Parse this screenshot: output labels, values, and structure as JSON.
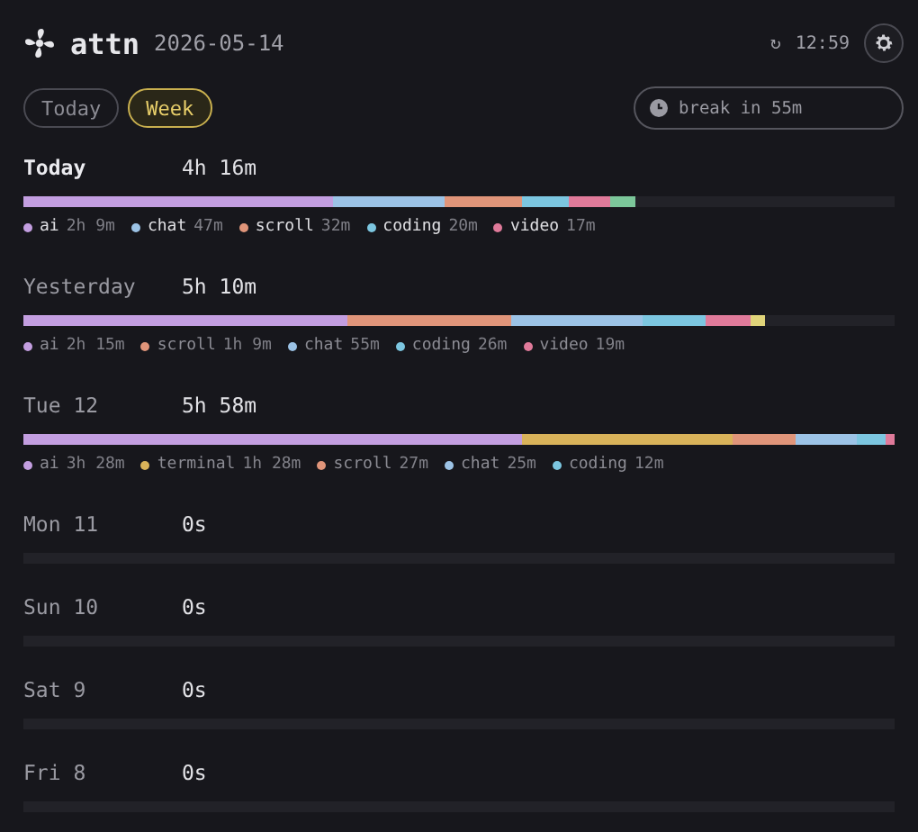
{
  "header": {
    "app_name": "attn",
    "date": "2026-05-14",
    "sync_icon": "↻",
    "time": "12:59"
  },
  "tabs": [
    {
      "label": "Today",
      "selected": false
    },
    {
      "label": "Week",
      "selected": true
    }
  ],
  "break_field": {
    "value": "break in 55m"
  },
  "days": [
    {
      "label": "Today",
      "total": "4h 16m",
      "selected": true,
      "segments": [
        {
          "color": "#c39ee0"
        },
        {
          "color": "#9cc3e6"
        },
        {
          "color": "#e0957a"
        },
        {
          "color": "#7cc6e0"
        },
        {
          "color": "#e07a9a"
        },
        {
          "color": "#7cc79a"
        }
      ],
      "legend": [
        {
          "name": "ai",
          "value": "2h 9m",
          "color": "#c39ee0"
        },
        {
          "name": "chat",
          "value": "47m",
          "color": "#9cc3e6"
        },
        {
          "name": "scroll",
          "value": "32m",
          "color": "#e0957a"
        },
        {
          "name": "coding",
          "value": "20m",
          "color": "#7cc6e0"
        },
        {
          "name": "video",
          "value": "17m",
          "color": "#e07a9a"
        }
      ]
    },
    {
      "label": "Yesterday",
      "total": "5h 10m",
      "selected": false,
      "segments": [
        {
          "color": "#c39ee0"
        },
        {
          "color": "#e0957a"
        },
        {
          "color": "#9cc3e6"
        },
        {
          "color": "#7cc6e0"
        },
        {
          "color": "#e07a9a"
        },
        {
          "color": "#e0d47a"
        }
      ],
      "legend": [
        {
          "name": "ai",
          "value": "2h 15m",
          "color": "#c39ee0"
        },
        {
          "name": "scroll",
          "value": "1h 9m",
          "color": "#e0957a"
        },
        {
          "name": "chat",
          "value": "55m",
          "color": "#9cc3e6"
        },
        {
          "name": "coding",
          "value": "26m",
          "color": "#7cc6e0"
        },
        {
          "name": "video",
          "value": "19m",
          "color": "#e07a9a"
        }
      ]
    },
    {
      "label": "Tue 12",
      "total": "5h 58m",
      "selected": false,
      "segments": [
        {
          "color": "#c39ee0"
        },
        {
          "color": "#d9b35a"
        },
        {
          "color": "#e0957a"
        },
        {
          "color": "#9cc3e6"
        },
        {
          "color": "#7cc6e0"
        },
        {
          "color": "#e07a9a"
        }
      ],
      "legend": [
        {
          "name": "ai",
          "value": "3h 28m",
          "color": "#c39ee0"
        },
        {
          "name": "terminal",
          "value": "1h 28m",
          "color": "#d9b35a"
        },
        {
          "name": "scroll",
          "value": "27m",
          "color": "#e0957a"
        },
        {
          "name": "chat",
          "value": "25m",
          "color": "#9cc3e6"
        },
        {
          "name": "coding",
          "value": "12m",
          "color": "#7cc6e0"
        }
      ]
    },
    {
      "label": "Mon 11",
      "total": "0s",
      "selected": false
    },
    {
      "label": "Sun 10",
      "total": "0s",
      "selected": false
    },
    {
      "label": "Sat 9",
      "total": "0s",
      "selected": false
    },
    {
      "label": "Fri 8",
      "total": "0s",
      "selected": false
    }
  ]
}
